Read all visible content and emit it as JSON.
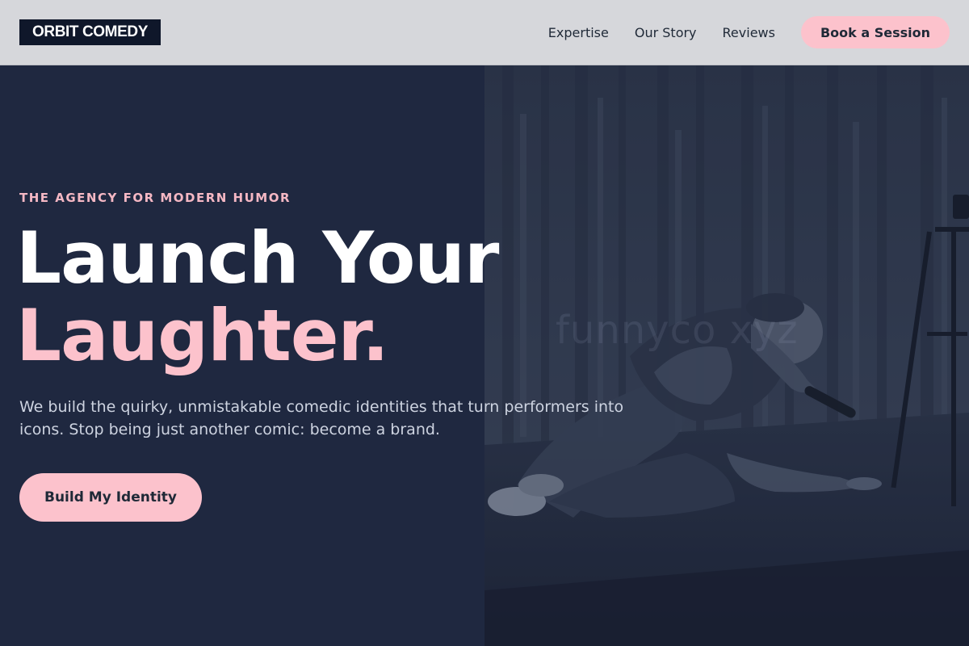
{
  "header": {
    "logo": "ORBIT COMEDY",
    "nav": [
      "Expertise",
      "Our Story",
      "Reviews"
    ],
    "cta": "Book a Session"
  },
  "hero": {
    "eyebrow": "THE AGENCY FOR MODERN HUMOR",
    "headline_line1": "Launch Your",
    "headline_line2": "Laughter.",
    "subtext": "We build the quirky, unmistakable comedic identities that turn performers into icons. Stop being just another comic: become a brand.",
    "cta": "Build My Identity",
    "image_watermark": "funnyco xyz"
  },
  "colors": {
    "accent": "#fcc2cc",
    "dark": "#1f2840",
    "header_bg": "#d6d7db"
  }
}
